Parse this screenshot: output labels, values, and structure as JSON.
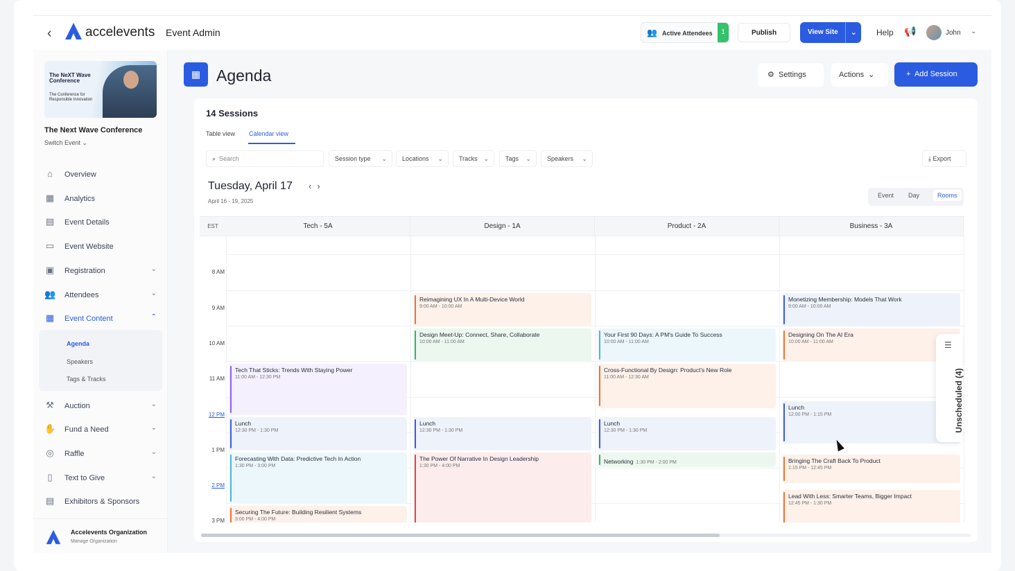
{
  "header": {
    "brand": "accelevents",
    "section": "Event Admin",
    "active_attendees_label": "Active Attendees",
    "active_attendees_count": "1",
    "publish": "Publish",
    "view_site": "View Site",
    "help": "Help",
    "user": "John"
  },
  "sidebar": {
    "banner_title": "The NeXT Wave Conference",
    "banner_sub": "The Conference for Responsible Innovation",
    "event_name": "The Next Wave Conference",
    "switch_event": "Switch Event",
    "items": [
      {
        "label": "Overview",
        "icon": "home-icon"
      },
      {
        "label": "Analytics",
        "icon": "chart-icon"
      },
      {
        "label": "Event Details",
        "icon": "calendar-edit-icon"
      },
      {
        "label": "Event Website",
        "icon": "window-icon"
      },
      {
        "label": "Registration",
        "icon": "ticket-icon"
      },
      {
        "label": "Attendees",
        "icon": "people-icon"
      },
      {
        "label": "Event Content",
        "icon": "calendar-icon"
      },
      {
        "label": "Auction",
        "icon": "gavel-icon"
      },
      {
        "label": "Fund a Need",
        "icon": "hand-coin-icon"
      },
      {
        "label": "Raffle",
        "icon": "raffle-icon"
      },
      {
        "label": "Text to Give",
        "icon": "phone-icon"
      },
      {
        "label": "Exhibitors & Sponsors",
        "icon": "booth-icon"
      }
    ],
    "sub_items": [
      "Agenda",
      "Speakers",
      "Tags & Tracks"
    ],
    "org_name": "Accelevents Organization",
    "org_manage": "Manage Organization"
  },
  "page": {
    "title": "Agenda",
    "settings": "Settings",
    "actions": "Actions",
    "add_session": "Add Session",
    "sessions_count": "14 Sessions",
    "tabs": [
      "Table view",
      "Calendar view"
    ],
    "search_placeholder": "Search",
    "filters": [
      "Session type",
      "Locations",
      "Tracks",
      "Tags",
      "Speakers"
    ],
    "export": "Export",
    "date": "Tuesday, April 17",
    "date_range": "April 16 - 19, 2025",
    "view_modes": [
      "Event",
      "Day",
      "Rooms"
    ],
    "timezone": "EST",
    "times": [
      "8 AM",
      "9 AM",
      "10 AM",
      "11 AM",
      "12 PM",
      "1 PM",
      "2 PM",
      "3 PM"
    ],
    "rooms": [
      "Tech - 5A",
      "Design - 1A",
      "Product - 2A",
      "Business - 3A"
    ],
    "unscheduled": "Unscheduled (4)"
  },
  "events": [
    {
      "room": 0,
      "title": "Tech That Sticks: Trends With Staying Power",
      "time": "11:00 AM - 12:30 PM",
      "start": 11.0,
      "end": 12.5,
      "color": "#8b5cf6",
      "bg": "#f4f0fd"
    },
    {
      "room": 0,
      "title": "Lunch",
      "time": "12:30 PM - 1:30 PM",
      "start": 12.5,
      "end": 13.5,
      "color": "#3b5bdb",
      "bg": "#eef2fb"
    },
    {
      "room": 0,
      "title": "Forecasting With Data: Predictive Tech In Action",
      "time": "1:30 PM - 3:00 PM",
      "start": 13.5,
      "end": 15.0,
      "color": "#4fb4d8",
      "bg": "#ecf7fb"
    },
    {
      "room": 0,
      "title": "Securing The Future: Building Resilient Systems",
      "time": "3:00 PM - 4:00 PM",
      "start": 15.0,
      "end": 16.0,
      "color": "#e8743b",
      "bg": "#fdf1ea"
    },
    {
      "room": 1,
      "title": "Reimagining UX In A Multi-Device World",
      "time": "9:00 AM - 10:00 AM",
      "start": 9.0,
      "end": 10.0,
      "color": "#e8743b",
      "bg": "#fdf1ea"
    },
    {
      "room": 1,
      "title": "Design Meet-Up: Connect, Share, Collaborate",
      "time": "10:00 AM - 11:00 AM",
      "start": 10.0,
      "end": 11.0,
      "color": "#37b26c",
      "bg": "#ebf7ef"
    },
    {
      "room": 1,
      "title": "Lunch",
      "time": "12:30 PM - 1:30 PM",
      "start": 12.5,
      "end": 13.5,
      "color": "#3b5bdb",
      "bg": "#eef2fb"
    },
    {
      "room": 1,
      "title": "The Power Of Narrative In Design Leadership",
      "time": "1:30 PM - 4:00 PM",
      "start": 13.5,
      "end": 16.0,
      "color": "#d94848",
      "bg": "#fcecec"
    },
    {
      "room": 2,
      "title": "Your First 90 Days: A PM's Guide To Success",
      "time": "10:00 AM - 11:00 AM",
      "start": 10.0,
      "end": 11.0,
      "color": "#4fb4d8",
      "bg": "#ecf7fb"
    },
    {
      "room": 2,
      "title": "Cross-Functional By Design: Product's New Role",
      "time": "11:00 AM - 12:30 AM",
      "start": 11.0,
      "end": 12.3,
      "color": "#e8743b",
      "bg": "#fdf1ea"
    },
    {
      "room": 2,
      "title": "Lunch",
      "time": "12:30 PM - 1:30 PM",
      "start": 12.5,
      "end": 13.5,
      "color": "#3b5bdb",
      "bg": "#eef2fb"
    },
    {
      "room": 2,
      "title": "Networking",
      "time": "1:30 PM - 2:00 PM",
      "start": 13.5,
      "end": 13.95,
      "color": "#37b26c",
      "bg": "#ebf7ef",
      "inline": true
    },
    {
      "room": 3,
      "title": "Monetizing Membership: Models That Work",
      "time": "9:00 AM - 10:00 AM",
      "start": 9.0,
      "end": 10.0,
      "color": "#3b5bdb",
      "bg": "#eef2fb"
    },
    {
      "room": 3,
      "title": "Designing On The AI Era",
      "time": "10:00 AM - 11:00 AM",
      "start": 10.0,
      "end": 11.0,
      "color": "#e8743b",
      "bg": "#fdf1ea"
    },
    {
      "room": 3,
      "title": "Lunch",
      "time": "12:00 PM - 1:15 PM",
      "start": 12.05,
      "end": 13.3,
      "color": "#3b5bdb",
      "bg": "#eef2fb"
    },
    {
      "room": 3,
      "title": "Bringing The Craft Back To Product",
      "time": "1:15 PM - 12:45 PM",
      "start": 13.55,
      "end": 14.4,
      "color": "#e8743b",
      "bg": "#fdf1ea"
    },
    {
      "room": 3,
      "title": "Lead With Less: Smarter Teams, Bigger Impact",
      "time": "12:45 PM - 1:30 PM",
      "start": 14.55,
      "end": 15.7,
      "color": "#e8743b",
      "bg": "#fdf1ea"
    }
  ],
  "colors": {
    "accent": "#2b5be0",
    "success": "#34c26b"
  }
}
